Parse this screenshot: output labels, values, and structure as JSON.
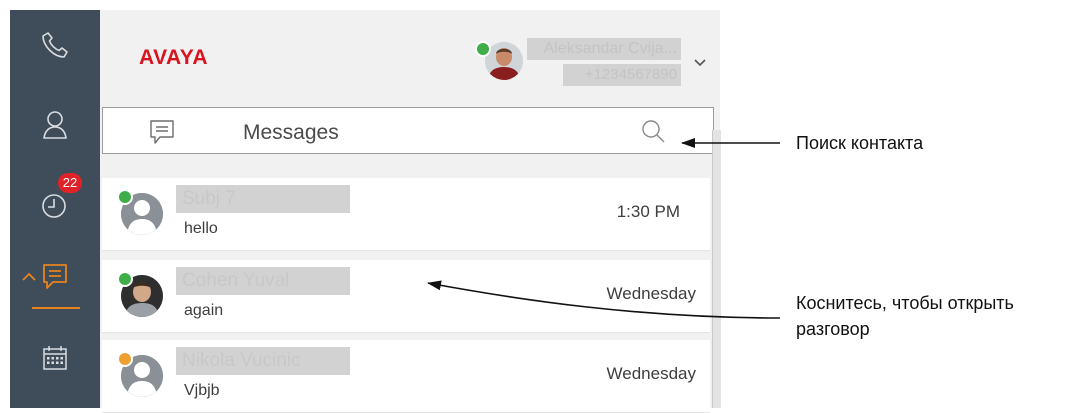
{
  "brand": {
    "logo_text": "AVAYA",
    "accent": "#e8841f",
    "logo_color": "#d8141e"
  },
  "user": {
    "name": "Aleksandar Cvija...",
    "extension": "+1234567890"
  },
  "nav": {
    "items": [
      {
        "name": "phone",
        "icon": "phone-icon"
      },
      {
        "name": "contacts",
        "icon": "person-icon"
      },
      {
        "name": "history",
        "icon": "clock-icon",
        "badge": "22"
      },
      {
        "name": "messages",
        "icon": "chat-icon",
        "active": true
      },
      {
        "name": "calendar",
        "icon": "calendar-icon"
      }
    ]
  },
  "messages_bar": {
    "title": "Messages"
  },
  "conversations": [
    {
      "name": "Subj 7",
      "snippet": "hello",
      "time": "1:30 PM",
      "presence": "available",
      "avatar": "generic"
    },
    {
      "name": "Cohen Yuval",
      "snippet": "again",
      "time": "Wednesday",
      "presence": "available",
      "avatar": "photo"
    },
    {
      "name": "Nikola Vucinic",
      "snippet": "Vjbjb",
      "time": "Wednesday",
      "presence": "away",
      "avatar": "generic"
    }
  ],
  "annotations": {
    "search": "Поиск контакта",
    "open_line1": "Коснитесь, чтобы открыть",
    "open_line2": "разговор"
  }
}
